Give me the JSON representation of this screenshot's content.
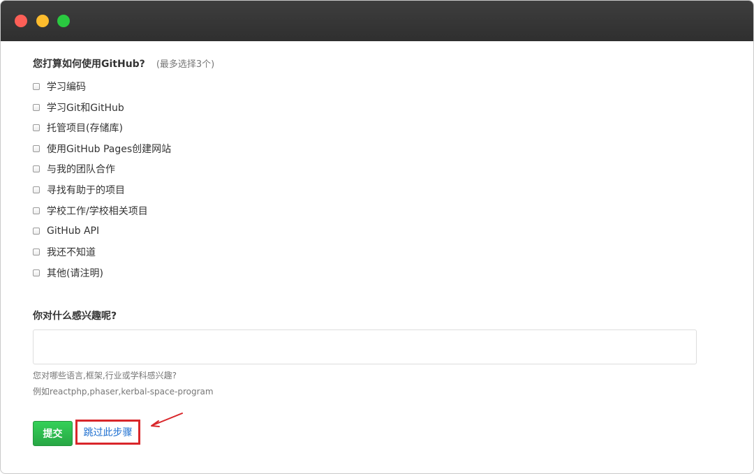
{
  "question": {
    "title": "您打算如何使用GitHub?",
    "hint": "(最多选择3个)",
    "options": [
      "学习编码",
      "学习Git和GitHub",
      "托管项目(存储库)",
      "使用GitHub Pages创建网站",
      "与我的团队合作",
      "寻找有助于的项目",
      "学校工作/学校相关项目",
      "GitHub API",
      "我还不知道",
      "其他(请注明)"
    ]
  },
  "interests": {
    "title": "你对什么感兴趣呢?",
    "value": "",
    "note_line1": "您对哪些语言,框架,行业或学科感兴趣?",
    "note_line2": "例如reactphp,phaser,kerbal-space-program"
  },
  "actions": {
    "submit_label": "提交",
    "skip_label": "跳过此步骤",
    "submit_color": "#2ea44f",
    "skip_link_color": "#1d6fd0",
    "highlight_color": "#d9262a"
  },
  "window_controls": {
    "close_color": "#fd5f57",
    "minimize_color": "#fdbc2d",
    "zoom_color": "#2ac940"
  }
}
